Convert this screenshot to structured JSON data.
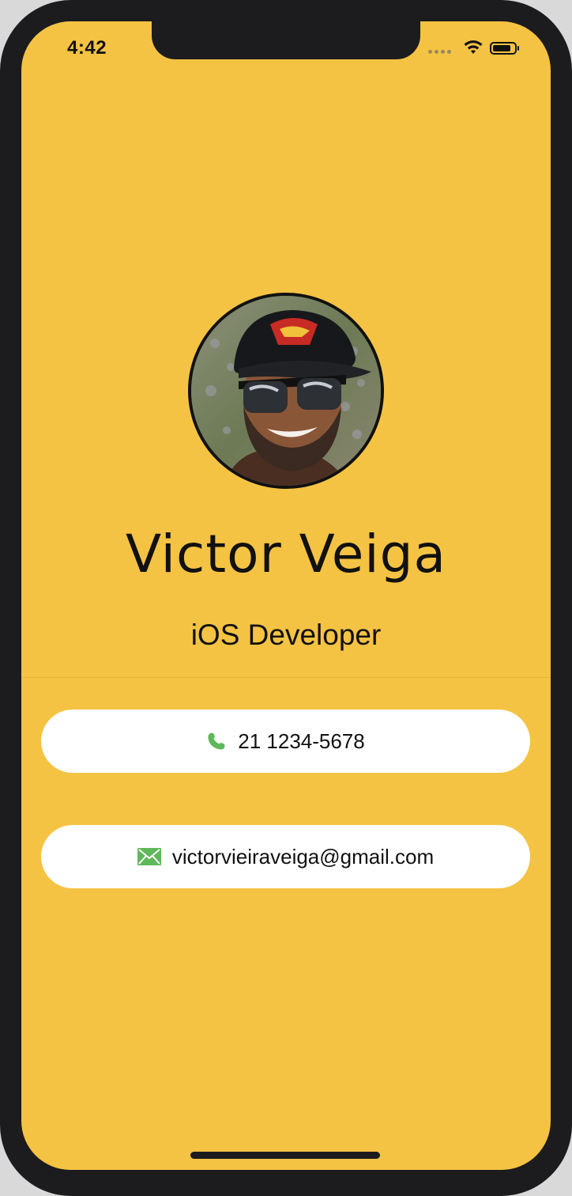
{
  "status_bar": {
    "time": "4:42",
    "battery_level": 0.85
  },
  "profile": {
    "name": "Victor Veiga",
    "title": "iOS Developer",
    "avatar_icon": "profile-photo"
  },
  "contacts": {
    "phone": {
      "icon": "phone-icon",
      "label": "21 1234-5678"
    },
    "email": {
      "icon": "envelope-icon",
      "label": "victorvieiraveiga@gmail.com"
    }
  },
  "colors": {
    "background": "#f5c343",
    "card": "#ffffff",
    "icon_accent": "#5fb85a",
    "text": "#111111"
  }
}
